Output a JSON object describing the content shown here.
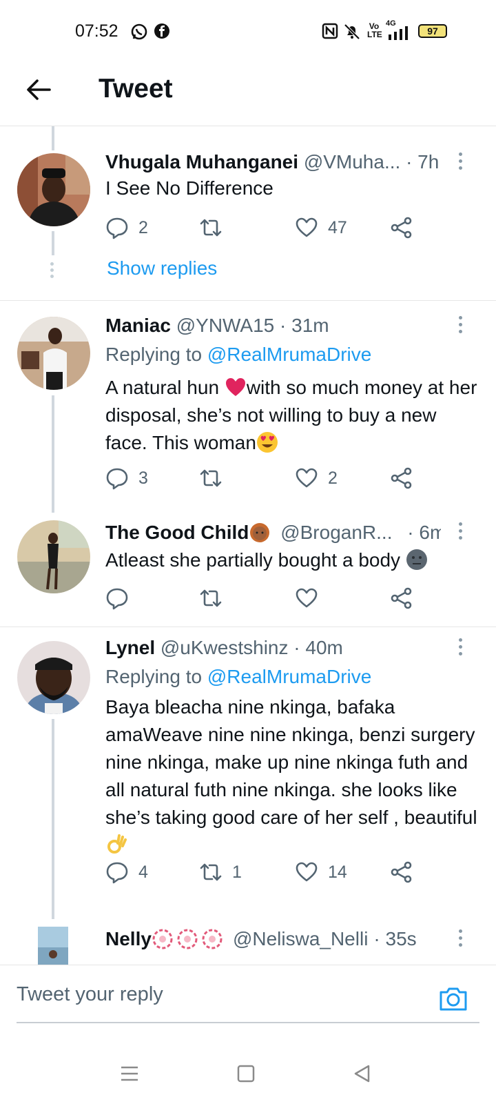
{
  "status_bar": {
    "time": "07:52",
    "network": "4G",
    "volte": "Vo LTE",
    "battery": "97",
    "icons": [
      "whatsapp-icon",
      "facebook-icon",
      "nfc-icon",
      "mute-icon",
      "signal-icon",
      "battery-icon"
    ]
  },
  "header": {
    "title": "Tweet",
    "back_icon": "arrow-left-icon"
  },
  "tweets": [
    {
      "name": "Vhugala Muhanganei",
      "handle": "@VMuha...",
      "time": "· 7h",
      "text": "I See No Difference",
      "replies": "2",
      "retweets": "",
      "likes": "47",
      "show_replies": "Show replies"
    },
    {
      "name": "Maniac",
      "handle": "@YNWA15",
      "time": "· 31m",
      "replying_prefix": "Replying to ",
      "replying_to": "@RealMrumaDrive",
      "text_1": "A natural hun ",
      "text_2": "with so much money at her disposal, she’s not willing to buy a new face. This woman",
      "replies": "3",
      "retweets": "",
      "likes": "2"
    },
    {
      "name": "The Good Child",
      "handle": "@BroganR...",
      "time": "· 6m",
      "text": "Atleast she partially bought a body ",
      "replies": "",
      "retweets": "",
      "likes": ""
    },
    {
      "name": "Lynel",
      "handle": "@uKwestshinz",
      "time": "· 40m",
      "replying_prefix": "Replying to ",
      "replying_to": "@RealMrumaDrive",
      "text": "Baya bleacha nine nkinga, bafaka amaWeave nine nine nkinga, benzi surgery nine nkinga, make up nine nkinga futh and all natural futh nine nkinga. she looks like she’s taking good care of her self , beautiful ",
      "replies": "4",
      "retweets": "1",
      "likes": "14"
    },
    {
      "name": "Nelly",
      "handle": "@Neliswa_Nelli",
      "time": "· 35s"
    }
  ],
  "composer": {
    "placeholder": "Tweet your reply",
    "camera_icon": "camera-icon"
  },
  "nav": [
    "menu-icon",
    "home-square-icon",
    "back-triangle-icon"
  ],
  "colors": {
    "accent": "#1d9bf0",
    "muted": "#536471",
    "heart": "#e0245e"
  }
}
